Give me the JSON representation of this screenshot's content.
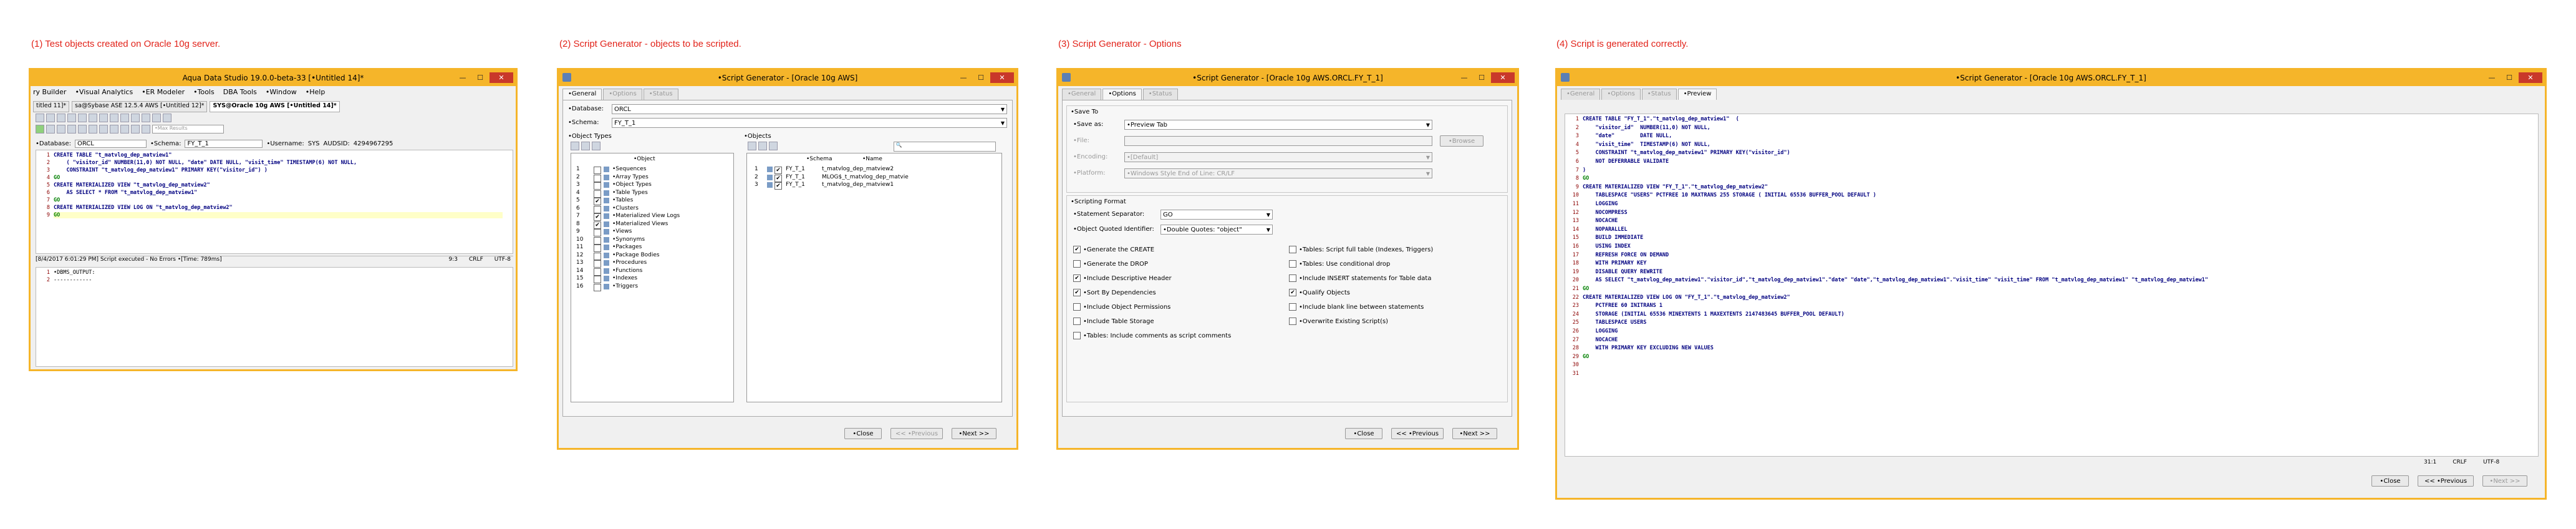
{
  "captions": [
    "(1)  Test objects created on Oracle 10g server.",
    "(2)  Script Generator - objects to be scripted.",
    "(3)  Script Generator - Options",
    "(4)  Script is generated correctly."
  ],
  "win1": {
    "title": "Aqua Data Studio 19.0.0-beta-33 [•Untitled 14]*",
    "menu": [
      "ry Builder",
      "•Visual Analytics",
      "•ER Modeler",
      "•Tools",
      "DBA Tools",
      "•Window",
      "•Help"
    ],
    "doc_tabs": [
      "titled 11]*",
      "sa@Sybase ASE 12.5.4 AWS [•Untitled 12]*",
      "SYS@Oracle 10g AWS [•Untitled 14]*"
    ],
    "search_placeholder": "•Max Results",
    "database_label": "•Database:",
    "database_value": "ORCL",
    "schema_label": "•Schema:",
    "schema_value": "FY_T_1",
    "username_label": "•Username:",
    "username_value": "SYS",
    "audsid_label": "AUDSID:",
    "audsid_value": "4294967295",
    "code": [
      "CREATE TABLE \"t_matvlog_dep_matview1\"",
      "    ( \"visitor_id\" NUMBER(11,0) NOT NULL, \"date\" DATE NULL, \"visit_time\" TIMESTAMP(6) NOT NULL,",
      "    CONSTRAINT \"t_matvlog_dep_matview1\" PRIMARY KEY(\"visitor_id\") )",
      "GO",
      "CREATE MATERIALIZED VIEW \"t_matvlog_dep_matview2\"",
      "    AS SELECT * FROM \"t_matvlog_dep_matview1\"",
      "GO",
      "CREATE MATERIALIZED VIEW LOG ON \"t_matvlog_dep_matview2\"",
      "GO"
    ],
    "status": "[8/4/2017 6:01:29 PM] Script executed - No Errors •[Time: 789ms]",
    "cursor": "9:3",
    "eol": "CRLF",
    "encoding": "UTF-8",
    "output": [
      "•DBMS_OUTPUT:",
      "------------"
    ]
  },
  "win2": {
    "title": "•Script Generator - [Oracle 10g AWS]",
    "tabs": [
      "•General",
      "•Options",
      "•Status"
    ],
    "database_label": "•Database:",
    "database_value": "ORCL",
    "schema_label": "•Schema:",
    "schema_value": "FY_T_1",
    "object_types_label": "•Object Types",
    "objects_label": "•Objects",
    "object_col": "•Object",
    "object_types": [
      {
        "n": "1",
        "t": "•Sequences",
        "c": false
      },
      {
        "n": "2",
        "t": "•Array Types",
        "c": false
      },
      {
        "n": "3",
        "t": "•Object Types",
        "c": false
      },
      {
        "n": "4",
        "t": "•Table Types",
        "c": false
      },
      {
        "n": "5",
        "t": "•Tables",
        "c": true
      },
      {
        "n": "6",
        "t": "•Clusters",
        "c": false
      },
      {
        "n": "7",
        "t": "•Materialized View Logs",
        "c": true
      },
      {
        "n": "8",
        "t": "•Materialized Views",
        "c": true
      },
      {
        "n": "9",
        "t": "•Views",
        "c": false
      },
      {
        "n": "10",
        "t": "•Synonyms",
        "c": false
      },
      {
        "n": "11",
        "t": "•Packages",
        "c": false
      },
      {
        "n": "12",
        "t": "•Package Bodies",
        "c": false
      },
      {
        "n": "13",
        "t": "•Procedures",
        "c": false
      },
      {
        "n": "14",
        "t": "•Functions",
        "c": false
      },
      {
        "n": "15",
        "t": "•Indexes",
        "c": false
      },
      {
        "n": "16",
        "t": "•Triggers",
        "c": false
      }
    ],
    "objects_cols": [
      "•Schema",
      "•Name"
    ],
    "objects": [
      {
        "n": "1",
        "s": "FY_T_1",
        "name": "t_matvlog_dep_matview2"
      },
      {
        "n": "2",
        "s": "FY_T_1",
        "name": "MLOG$_t_matvlog_dep_matvie"
      },
      {
        "n": "3",
        "s": "FY_T_1",
        "name": "t_matvlog_dep_matview1"
      }
    ],
    "close": "•Close",
    "prev": "<< •Previous",
    "next": "•Next >>"
  },
  "win3": {
    "title": "•Script Generator - [Oracle 10g AWS.ORCL.FY_T_1]",
    "tabs": [
      "•General",
      "•Options",
      "•Status"
    ],
    "save_to": "•Save To",
    "save_as_label": "•Save as:",
    "save_as_value": "•Preview Tab",
    "file_label": "•File:",
    "browse": "•Browse",
    "encoding_label": "•Encoding:",
    "encoding_value": "•[Default]",
    "platform_label": "•Platform:",
    "platform_value": "•Windows Style End of Line: CR/LF",
    "scripting_format": "•Scripting Format",
    "sep_label": "•Statement Separator:",
    "sep_value": "GO",
    "quoted_label": "•Object Quoted Identifier:",
    "quoted_value": "•Double Quotes: \"object\"",
    "left_opts": [
      {
        "t": "•Generate the CREATE",
        "c": true
      },
      {
        "t": "•Generate the DROP",
        "c": false
      },
      {
        "t": "•Include Descriptive Header",
        "c": true
      },
      {
        "t": "•Sort By Dependencies",
        "c": true
      },
      {
        "t": "•Include Object Permissions",
        "c": false
      },
      {
        "t": "•Include Table Storage",
        "c": false
      },
      {
        "t": "•Tables: Include comments as script comments",
        "c": false
      }
    ],
    "right_opts": [
      {
        "t": "•Tables: Script full table (Indexes, Triggers)",
        "c": false
      },
      {
        "t": "•Tables: Use conditional drop",
        "c": false
      },
      {
        "t": "•Include INSERT statements for Table data",
        "c": false
      },
      {
        "t": "•Qualify Objects",
        "c": true
      },
      {
        "t": "•Include blank line between statements",
        "c": false
      },
      {
        "t": "•Overwrite Existing Script(s)",
        "c": false
      }
    ],
    "close": "•Close",
    "prev": "<< •Previous",
    "next": "•Next >>"
  },
  "win4": {
    "title": "•Script Generator - [Oracle 10g AWS.ORCL.FY_T_1]",
    "tabs": [
      "•General",
      "•Options",
      "•Status",
      "•Preview"
    ],
    "code": [
      "CREATE TABLE \"FY_T_1\".\"t_matvlog_dep_matview1\"  (",
      "    \"visitor_id\"  NUMBER(11,0) NOT NULL,",
      "    \"date\"        DATE NULL,",
      "    \"visit_time\"  TIMESTAMP(6) NOT NULL,",
      "    CONSTRAINT \"t_matvlog_dep_matview1\" PRIMARY KEY(\"visitor_id\")",
      "    NOT DEFERRABLE VALIDATE",
      ")",
      "GO",
      "CREATE MATERIALIZED VIEW \"FY_T_1\".\"t_matvlog_dep_matview2\"",
      "    TABLESPACE \"USERS\" PCTFREE 10 MAXTRANS 255 STORAGE ( INITIAL 65536 BUFFER_POOL DEFAULT )",
      "    LOGGING",
      "    NOCOMPRESS",
      "    NOCACHE",
      "    NOPARALLEL",
      "    BUILD IMMEDIATE",
      "    USING INDEX",
      "    REFRESH FORCE ON DEMAND",
      "    WITH PRIMARY KEY",
      "    DISABLE QUERY REWRITE",
      "    AS SELECT \"t_matvlog_dep_matview1\".\"visitor_id\",\"t_matvlog_dep_matview1\".\"date\" \"date\",\"t_matvlog_dep_matview1\".\"visit_time\" \"visit_time\" FROM \"t_matvlog_dep_matview1\" \"t_matvlog_dep_matview1\"",
      "GO",
      "CREATE MATERIALIZED VIEW LOG ON \"FY_T_1\".\"t_matvlog_dep_matview2\"",
      "    PCTFREE 60 INITRANS 1",
      "    STORAGE (INITIAL 65536 MINEXTENTS 1 MAXEXTENTS 2147483645 BUFFER_POOL DEFAULT)",
      "    TABLESPACE USERS",
      "    LOGGING",
      "    NOCACHE",
      "    WITH PRIMARY KEY EXCLUDING NEW VALUES",
      "GO",
      "",
      ""
    ],
    "cursor": "31:1",
    "eol": "CRLF",
    "encoding": "UTF-8",
    "close": "•Close",
    "prev": "<< •Previous",
    "next": "•Next >>"
  }
}
